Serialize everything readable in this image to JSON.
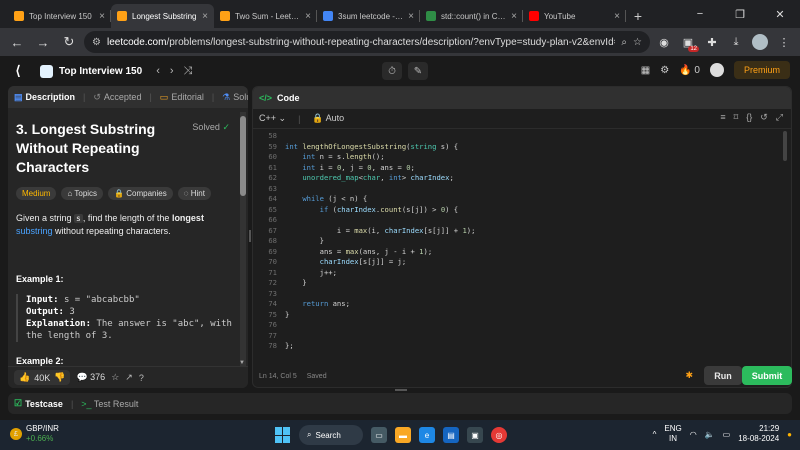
{
  "browser": {
    "tabs": [
      {
        "title": "Top Interview 150",
        "favicon": "leetcode-icon",
        "color": "#ffa116",
        "active": false
      },
      {
        "title": "Longest Substring",
        "favicon": "leetcode-icon",
        "color": "#ffa116",
        "active": true
      },
      {
        "title": "Two Sum - LeetCo",
        "favicon": "leetcode-icon",
        "color": "#ffa116",
        "active": false
      },
      {
        "title": "3sum leetcode - G",
        "favicon": "google-icon",
        "color": "#4285f4",
        "active": false
      },
      {
        "title": "std::count() in C++",
        "favicon": "gfg-icon",
        "color": "#2f8d46",
        "active": false
      },
      {
        "title": "YouTube",
        "favicon": "youtube-icon",
        "color": "#ff0000",
        "active": false
      }
    ],
    "new_tab": "+",
    "window_controls": [
      "−",
      "❐",
      "✕"
    ],
    "url_domain": "leetcode.com",
    "url_path": "/problems/longest-substring-without-repeating-characters/description/?envType=study-plan-v2&envId=top-i...",
    "ext_badge": "12"
  },
  "lc_header": {
    "study_plan": "Top Interview 150",
    "streak_count": "0",
    "premium_label": "Premium"
  },
  "left_tabs": [
    {
      "label": "Description",
      "icon": "doc-icon",
      "active": true
    },
    {
      "label": "Accepted",
      "icon": "history-icon",
      "active": false
    },
    {
      "label": "Editorial",
      "icon": "book-icon",
      "active": false
    },
    {
      "label": "Solution",
      "icon": "flask-icon",
      "active": false
    }
  ],
  "problem": {
    "title": "3. Longest Substring Without Repeating Characters",
    "status": "Solved",
    "chips": {
      "difficulty": "Medium",
      "topics": "Topics",
      "companies": "Companies",
      "hint": "Hint"
    },
    "desc_pre": "Given a string ",
    "desc_var": "s",
    "desc_mid": ", find the length of the ",
    "desc_bold": "longest",
    "desc_link": "substring",
    "desc_post": "without repeating characters.",
    "example1_heading": "Example 1:",
    "example1_input_label": "Input:",
    "example1_input": "s = \"abcabcbb\"",
    "example1_output_label": "Output:",
    "example1_output": "3",
    "example1_expl_label": "Explanation:",
    "example1_expl": "The answer is \"abc\", with the length of 3.",
    "example2_heading": "Example 2:"
  },
  "left_footer": {
    "likes": "40K",
    "comments": "376"
  },
  "code_panel": {
    "title": "Code",
    "language": "C++",
    "autosave": "Auto",
    "cursor_pos": "Ln 14, Col 5",
    "save_status": "Saved",
    "run_label": "Run",
    "submit_label": "Submit"
  },
  "code_lines": [
    {
      "n": "58",
      "c": ""
    },
    {
      "n": "59",
      "c": "int lengthOfLongestSubstring(string s) {"
    },
    {
      "n": "60",
      "c": "    int n = s.length();"
    },
    {
      "n": "61",
      "c": "    int i = 0, j = 0, ans = 0;"
    },
    {
      "n": "62",
      "c": "    unordered_map<char, int> charIndex;"
    },
    {
      "n": "63",
      "c": ""
    },
    {
      "n": "64",
      "c": "    while (j < n) {"
    },
    {
      "n": "65",
      "c": "        if (charIndex.count(s[j]) > 0) {"
    },
    {
      "n": "66",
      "c": ""
    },
    {
      "n": "67",
      "c": "            i = max(i, charIndex[s[j]] + 1);"
    },
    {
      "n": "68",
      "c": "        }"
    },
    {
      "n": "69",
      "c": "        ans = max(ans, j - i + 1);"
    },
    {
      "n": "70",
      "c": "        charIndex[s[j]] = j;"
    },
    {
      "n": "71",
      "c": "        j++;"
    },
    {
      "n": "72",
      "c": "    }"
    },
    {
      "n": "73",
      "c": ""
    },
    {
      "n": "74",
      "c": "    return ans;"
    },
    {
      "n": "75",
      "c": "}"
    },
    {
      "n": "76",
      "c": ""
    },
    {
      "n": "77",
      "c": ""
    },
    {
      "n": "78",
      "c": "};"
    }
  ],
  "testcase": {
    "tab1": "Testcase",
    "tab2": "Test Result"
  },
  "taskbar": {
    "ticker": "GBP/INR",
    "change": "+0.66%",
    "search": "Search",
    "lang_top": "ENG",
    "lang_bottom": "IN",
    "time": "21:29",
    "date": "18-08-2024"
  }
}
